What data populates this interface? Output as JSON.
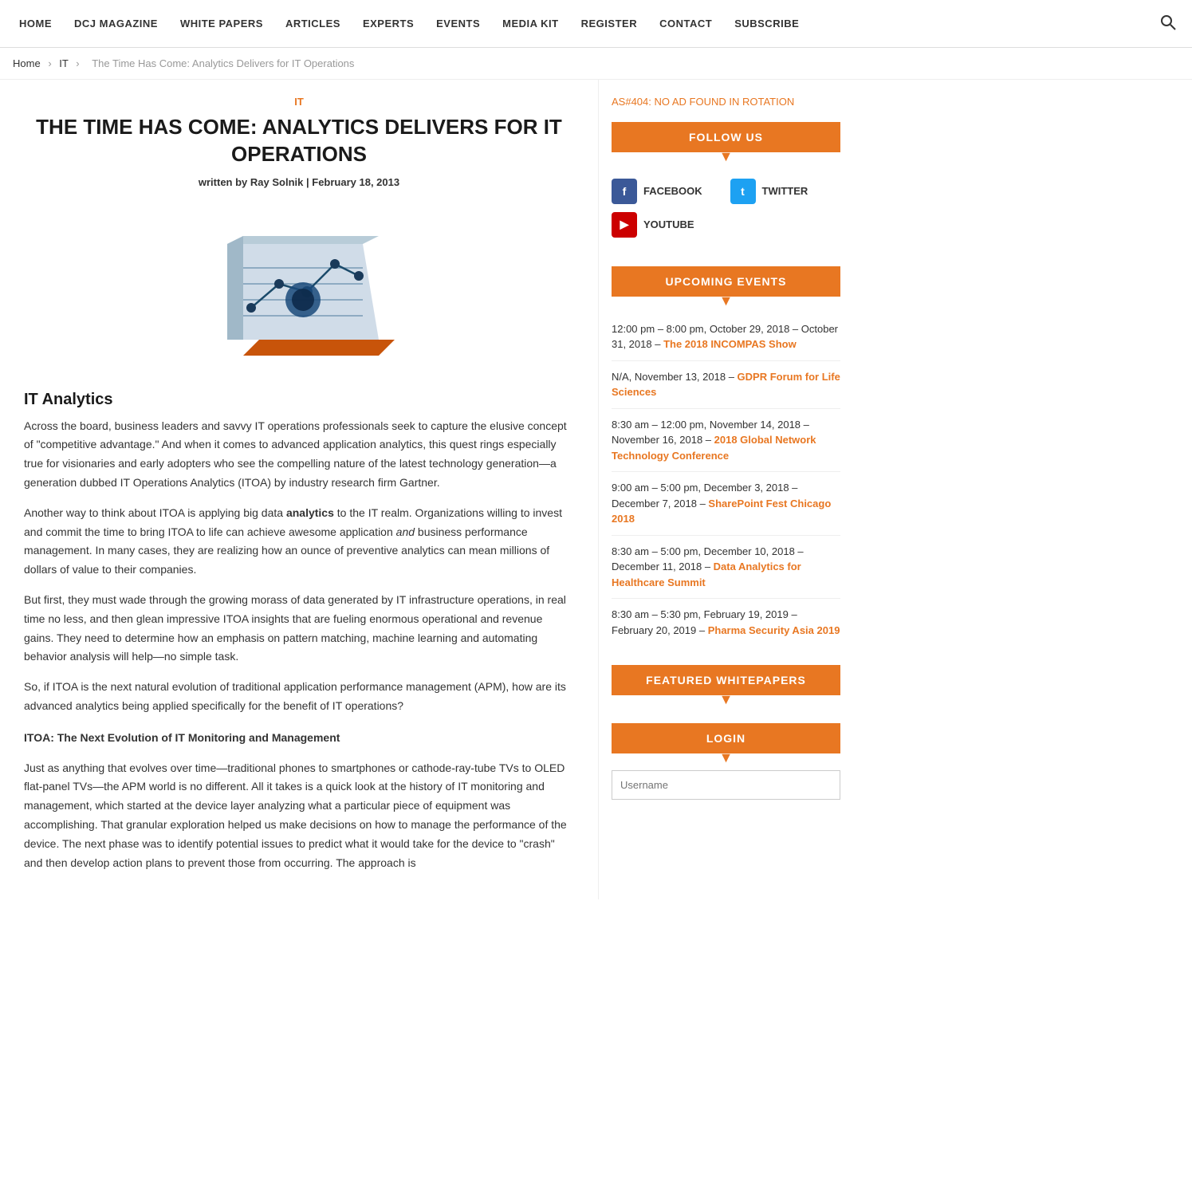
{
  "nav": {
    "items": [
      {
        "label": "HOME",
        "href": "#"
      },
      {
        "label": "DCJ MAGAZINE",
        "href": "#"
      },
      {
        "label": "WHITE PAPERS",
        "href": "#"
      },
      {
        "label": "ARTICLES",
        "href": "#"
      },
      {
        "label": "EXPERTS",
        "href": "#"
      },
      {
        "label": "EVENTS",
        "href": "#"
      },
      {
        "label": "MEDIA KIT",
        "href": "#"
      },
      {
        "label": "REGISTER",
        "href": "#"
      },
      {
        "label": "CONTACT",
        "href": "#"
      },
      {
        "label": "SUBSCRIBE",
        "href": "#"
      }
    ]
  },
  "breadcrumb": {
    "items": [
      {
        "label": "Home",
        "href": "#"
      },
      {
        "label": "IT",
        "href": "#"
      },
      {
        "label": "The Time Has Come: Analytics Delivers for IT Operations",
        "href": "#"
      }
    ]
  },
  "article": {
    "category": "IT",
    "title": "THE TIME HAS COME: ANALYTICS DELIVERS FOR IT OPERATIONS",
    "written_by_label": "written by",
    "author": "Ray Solnik",
    "date": "February 18, 2013",
    "section_heading": "IT Analytics",
    "paragraphs": [
      "Across the board, business leaders and savvy IT operations professionals seek to capture the elusive concept of \"competitive advantage.\" And when it comes to advanced application analytics, this quest rings especially true for visionaries and early adopters who see the compelling nature of the latest technology generation—a generation dubbed IT Operations Analytics (ITOA) by industry research firm Gartner.",
      "Another way to think about ITOA is applying big data analytics to the IT realm. Organizations willing to invest and commit the time to bring ITOA to life can achieve awesome application and business performance management. In many cases, they are realizing how an ounce of preventive analytics can mean millions of dollars of value to their companies.",
      "But first, they must wade through the growing morass of data generated by IT infrastructure operations, in real time no less, and then glean impressive ITOA insights that are fueling enormous operational and revenue gains. They need to determine how an emphasis on pattern matching, machine learning and automating behavior analysis will help—no simple task.",
      "So, if ITOA is the next natural evolution of traditional application performance management (APM), how are its advanced analytics being applied specifically for the benefit of IT operations?"
    ],
    "bold_word": "analytics",
    "italic_word": "and",
    "subheading": "ITOA: The Next Evolution of IT Monitoring and Management",
    "paragraph2": "Just as anything that evolves over time—traditional phones to smartphones or cathode-ray-tube TVs to OLED flat-panel TVs—the APM world is no different. All it takes is a quick look at the history of IT monitoring and management, which started at the device layer analyzing what a particular piece of equipment was accomplishing. That granular exploration helped us make decisions on how to manage the performance of the device. The next phase was to identify potential issues to predict what it would take for the device to \"crash\" and then develop action plans to prevent those from occurring. The approach is"
  },
  "sidebar": {
    "ad_notice": "AS#404: NO AD FOUND IN ROTATION",
    "follow_us": {
      "title": "FOLLOW US",
      "social": [
        {
          "platform": "FACEBOOK",
          "icon": "f",
          "color": "#3b5998",
          "name": "facebook-icon"
        },
        {
          "platform": "TWITTER",
          "icon": "t",
          "color": "#1da1f2",
          "name": "twitter-icon"
        },
        {
          "platform": "YOUTUBE",
          "icon": "▶",
          "color": "#cc0000",
          "name": "youtube-icon"
        }
      ]
    },
    "upcoming_events": {
      "title": "UPCOMING EVENTS",
      "events": [
        {
          "date_time": "12:00 pm – 8:00 pm, October 29, 2018 – October 31, 2018 –",
          "link_text": "The 2018 INCOMPAS Show",
          "href": "#"
        },
        {
          "date_time": "N/A, November 13, 2018 –",
          "link_text": "GDPR Forum for Life Sciences",
          "href": "#"
        },
        {
          "date_time": "8:30 am – 12:00 pm, November 14, 2018 – November 16, 2018 –",
          "link_text": "2018 Global Network Technology Conference",
          "href": "#"
        },
        {
          "date_time": "9:00 am – 5:00 pm, December 3, 2018 – December 7, 2018 –",
          "link_text": "SharePoint Fest Chicago 2018",
          "href": "#"
        },
        {
          "date_time": "8:30 am – 5:00 pm, December 10, 2018 – December 11, 2018 –",
          "link_text": "Data Analytics for Healthcare Summit",
          "href": "#"
        },
        {
          "date_time": "8:30 am – 5:30 pm, February 19, 2019 – February 20, 2019 –",
          "link_text": "Pharma Security Asia 2019",
          "href": "#"
        }
      ]
    },
    "featured_whitepapers": {
      "title": "FEATURED WHITEPAPERS"
    },
    "login": {
      "title": "LOGIN",
      "username_placeholder": "Username"
    }
  }
}
